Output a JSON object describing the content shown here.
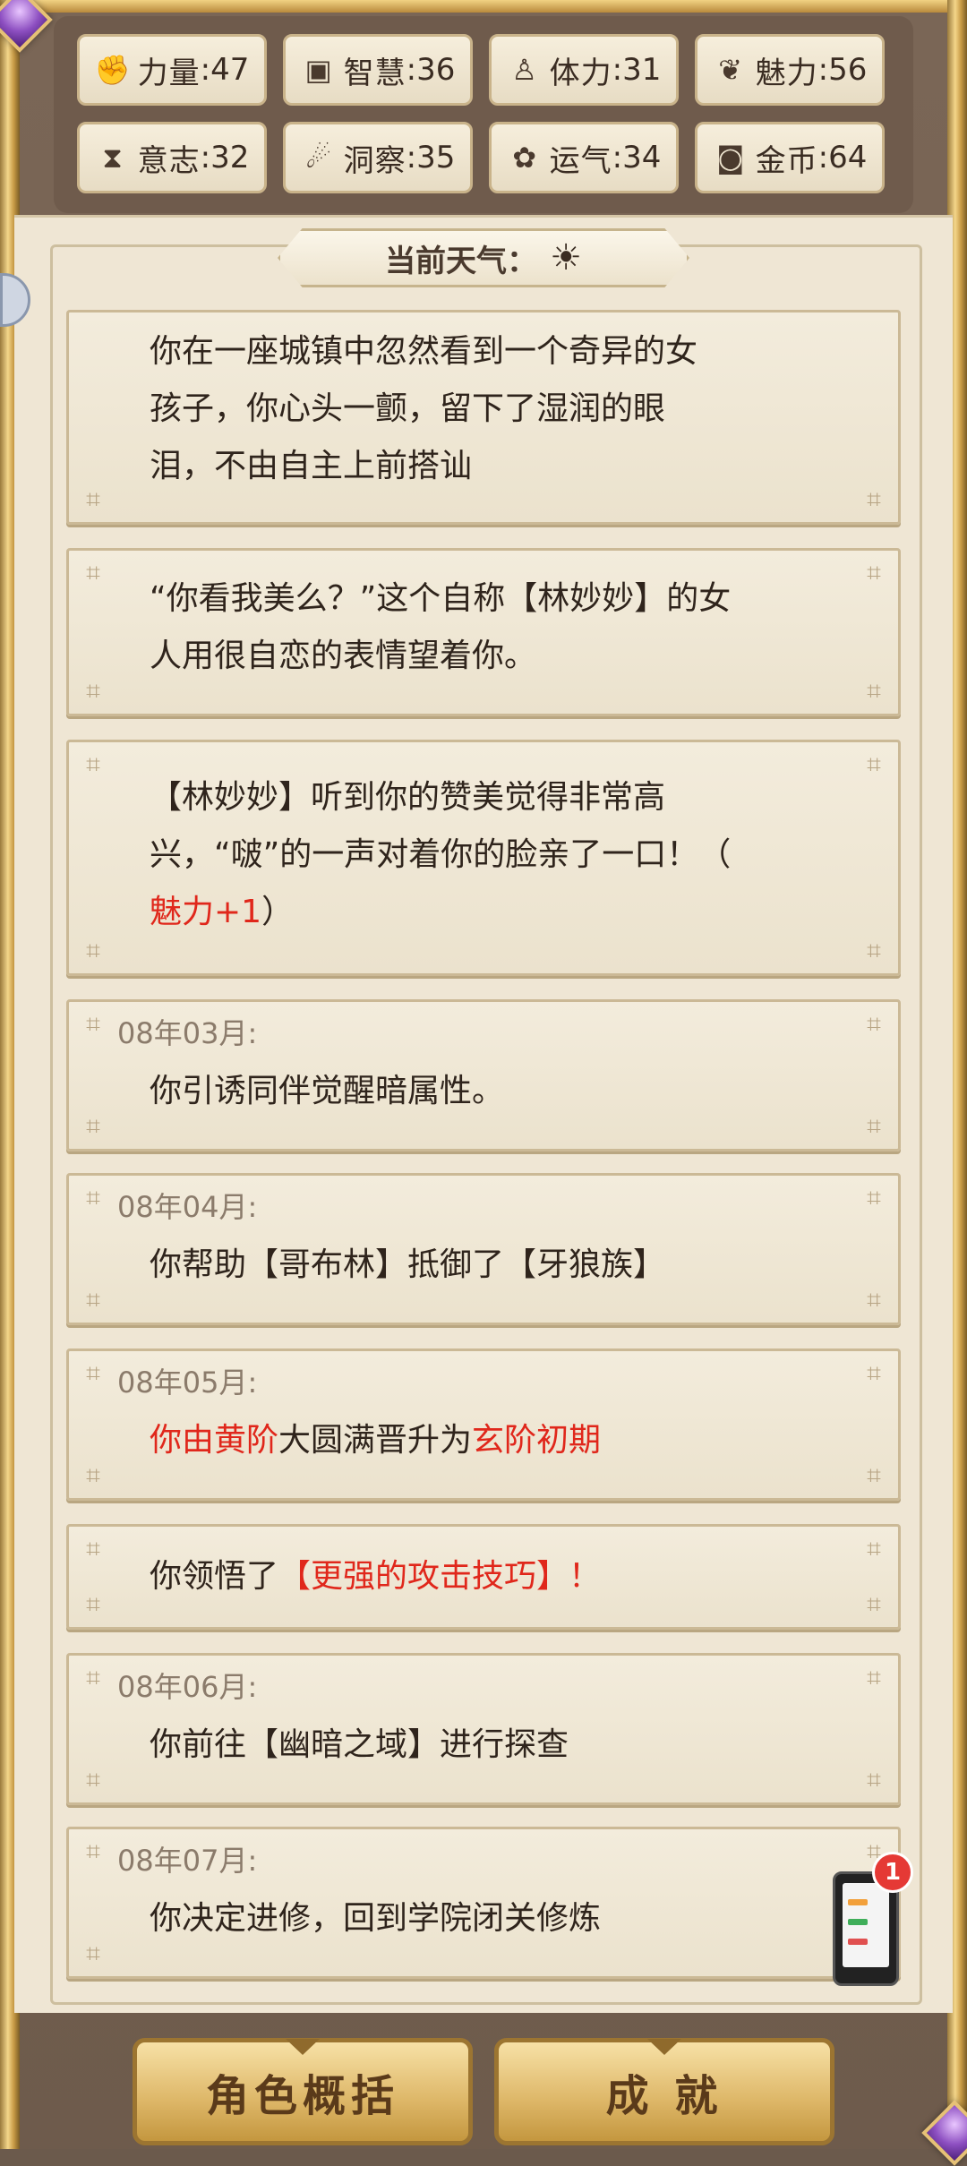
{
  "stats": [
    {
      "icon": "strength-icon",
      "label": "力量",
      "value": "47"
    },
    {
      "icon": "wisdom-icon",
      "label": "智慧",
      "value": "36"
    },
    {
      "icon": "stamina-icon",
      "label": "体力",
      "value": "31"
    },
    {
      "icon": "charm-icon",
      "label": "魅力",
      "value": "56"
    },
    {
      "icon": "will-icon",
      "label": "意志",
      "value": "32"
    },
    {
      "icon": "insight-icon",
      "label": "洞察",
      "value": "35"
    },
    {
      "icon": "luck-icon",
      "label": "运气",
      "value": "34"
    },
    {
      "icon": "coin-icon",
      "label": "金币",
      "value": "64"
    }
  ],
  "weather": {
    "label": "当前天气：",
    "icon": "sun-icon"
  },
  "events": [
    {
      "date": "",
      "line1": "你在一座城镇中忽然看到一个奇异的女",
      "line2": "孩子，你心头一颤，留下了湿润的眼",
      "line3": "泪，不由自主上前搭讪"
    },
    {
      "date": "",
      "line1": "“你看我美么？”这个自称【林妙妙】的女",
      "line2": "人用很自恋的表情望着你。"
    },
    {
      "date": "",
      "line1": "【林妙妙】听到你的赞美觉得非常高",
      "line2": "兴，“啵”的一声对着你的脸亲了一口！（",
      "line3_red": "魅力+1",
      "line3_rest": "）"
    },
    {
      "date": "08年03月:",
      "line1": "你引诱同伴觉醒暗属性。"
    },
    {
      "date": "08年04月:",
      "line1": "你帮助【哥布林】抵御了【牙狼族】"
    },
    {
      "date": "08年05月:",
      "red1": "你由黄阶",
      "mid": "大圆满晋升为",
      "red2": "玄阶初期"
    },
    {
      "date": "",
      "plain": "你领悟了",
      "red": "【更强的攻击技巧】！"
    },
    {
      "date": "08年06月:",
      "line1": "你前往【幽暗之域】进行探查"
    },
    {
      "date": "08年07月:",
      "line1": "你决定进修，回到学院闭关修炼"
    }
  ],
  "buttons": {
    "overview": "角色概括",
    "achievements": "成 就"
  },
  "notification": {
    "badge": "1"
  },
  "colors": {
    "accent_red": "#e0271b",
    "gold": "#ddb667",
    "paper": "#efe6d4"
  }
}
